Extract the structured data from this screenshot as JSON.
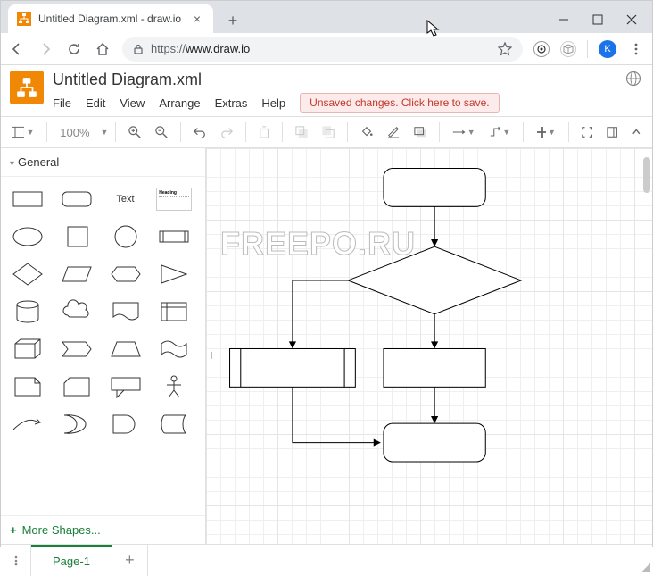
{
  "browser": {
    "tab_title": "Untitled Diagram.xml - draw.io",
    "url_scheme": "https://",
    "url_host": "www.draw.io",
    "user_initial": "K"
  },
  "app": {
    "title": "Untitled Diagram.xml",
    "warning": "Unsaved changes. Click here to save."
  },
  "menubar": {
    "file": "File",
    "edit": "Edit",
    "view": "View",
    "arrange": "Arrange",
    "extras": "Extras",
    "help": "Help"
  },
  "toolbar": {
    "zoom": "100%"
  },
  "sidebar": {
    "category": "General",
    "text_shape": "Text",
    "more": "More Shapes..."
  },
  "footer": {
    "page": "Page-1"
  },
  "watermark": "FREEPO.RU"
}
